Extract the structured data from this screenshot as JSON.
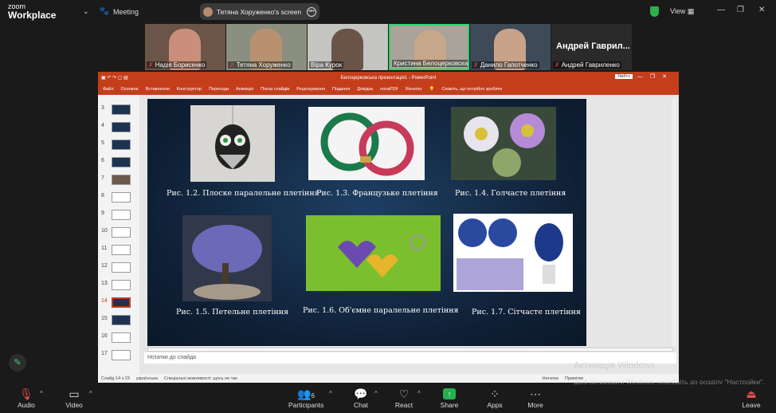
{
  "app": {
    "logo_line1": "zoom",
    "logo_line2": "Workplace",
    "meeting_label": "Meeting",
    "view_label": "View"
  },
  "share": {
    "title": "Тетяна Хоруженко's screen"
  },
  "participants_strip": [
    {
      "name": "Надія Борисенко",
      "muted": true
    },
    {
      "name": "Тетяна Хоруженко",
      "muted": true
    },
    {
      "name": "Віра Курок",
      "muted": false
    },
    {
      "name": "Кристина Белоцерковская",
      "muted": false,
      "active": true
    },
    {
      "name": "Данило Гапотченко",
      "muted": true
    },
    {
      "name": "Андрей Гавриленко",
      "muted": true,
      "big_label": "Андрей Гаврил..."
    }
  ],
  "powerpoint": {
    "title": "Белоцерковська презентація1 - PowerPoint",
    "enter_btn": "Увійти",
    "ribbon_tabs": [
      "Файл",
      "Основне",
      "Вставлення",
      "Конструктор",
      "Переходи",
      "Анімація",
      "Показ слайдів",
      "Рецензування",
      "Подання",
      "Довідка",
      "novaPDF",
      "Reverso"
    ],
    "tell_me": "Скажіть, що потрібно зробити",
    "slide_numbers": [
      "3",
      "4",
      "5",
      "6",
      "7",
      "8",
      "9",
      "10",
      "11",
      "12",
      "13",
      "14",
      "15",
      "16",
      "17"
    ],
    "selected_slide": "14",
    "notes_placeholder": "Нотатки до слайда",
    "status_slide": "Слайд 14 з 23",
    "status_lang": "українська",
    "status_access": "Спеціальні можливості: щось не так",
    "status_notes": "Нотатки",
    "status_comments": "Примітки",
    "captions": [
      "Рис. 1.2. Плоске паралельне плетіння",
      "Рис. 1.3. Французьке плетіння",
      "Рис. 1.4. Голчасте плетіння",
      "Рис. 1.5. Петельне плетіння",
      "Рис. 1.6. Об'ємне паралельне плетіння",
      "Рис. 1.7. Сітчасте плетіння"
    ]
  },
  "activation": {
    "title": "Активація Windows",
    "subtitle": "Щоб активувати Windows, перейдіть до розділу \"Настройки\"."
  },
  "toolbar": {
    "audio": "Audio",
    "video": "Video",
    "participants": "Participants",
    "participants_count": "6",
    "chat": "Chat",
    "react": "React",
    "share": "Share",
    "apps": "Apps",
    "more": "More",
    "leave": "Leave"
  },
  "colors": {
    "accent_green": "#2fd36b",
    "ppt_red": "#c43e1c",
    "slide_bg": "#132a45"
  }
}
